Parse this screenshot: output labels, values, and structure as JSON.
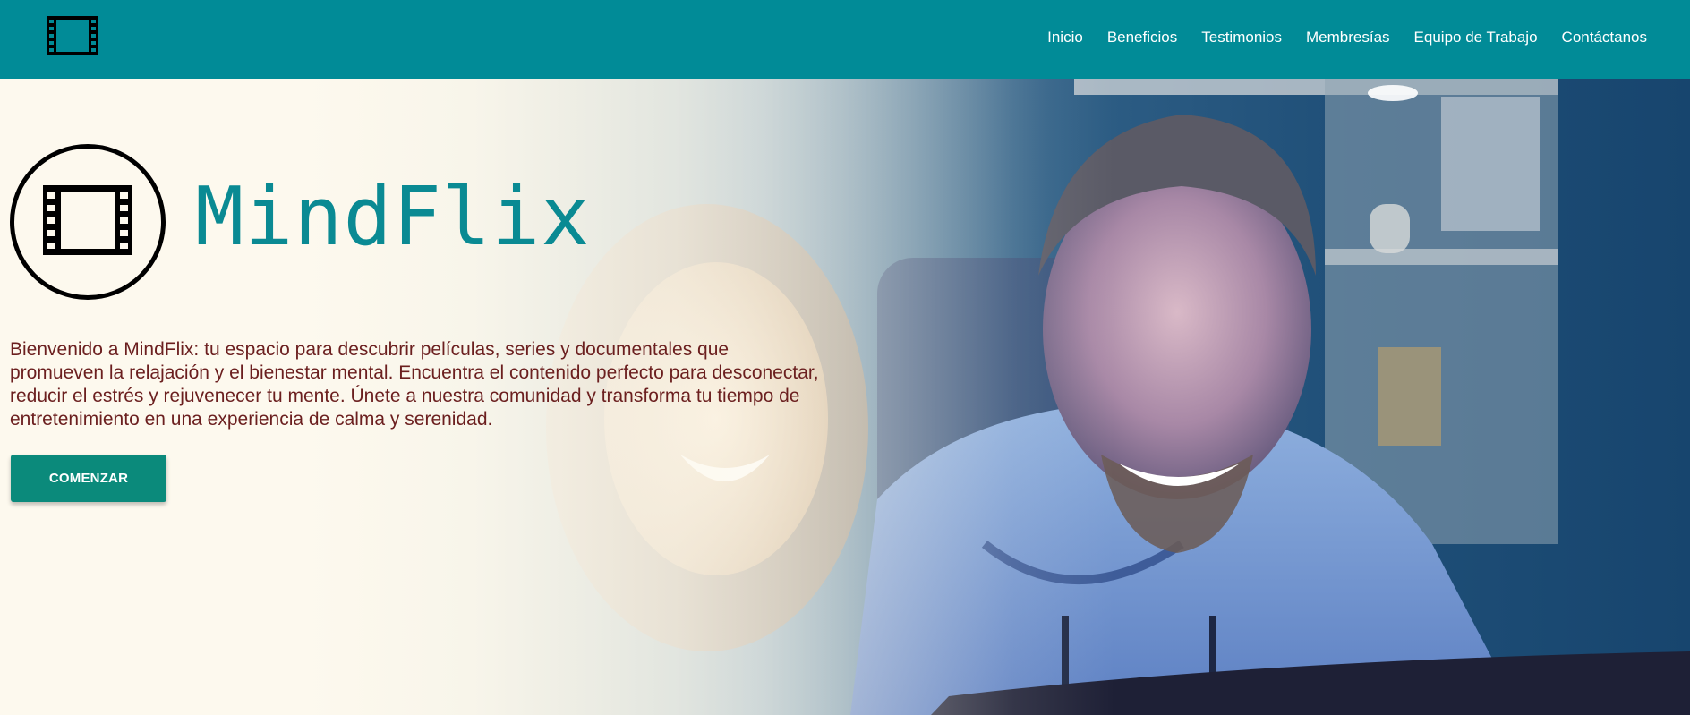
{
  "nav": {
    "logo_icon": "film-icon",
    "links": [
      {
        "label": "Inicio"
      },
      {
        "label": "Beneficios"
      },
      {
        "label": "Testimonios"
      },
      {
        "label": "Membresías"
      },
      {
        "label": "Equipo de Trabajo"
      },
      {
        "label": "Contáctanos"
      }
    ]
  },
  "hero": {
    "logo_icon": "film-icon",
    "brand": "MindFlix",
    "intro": "Bienvenido a MindFlix: tu espacio para descubrir películas, series y documentales que promueven la relajación y el bienestar mental. Encuentra el contenido perfecto para desconectar, reducir el estrés y rejuvenecer tu mente. Únete a nuestra comunidad y transforma tu tiempo de entretenimiento en una experiencia de calma y serenidad.",
    "cta_label": "COMENZAR"
  },
  "colors": {
    "nav_bg": "#018b97",
    "brand_text": "#0a8a93",
    "intro_text": "#6b1f1f",
    "cta_bg": "#0b8a7b",
    "page_bg": "#fdf9ee"
  }
}
